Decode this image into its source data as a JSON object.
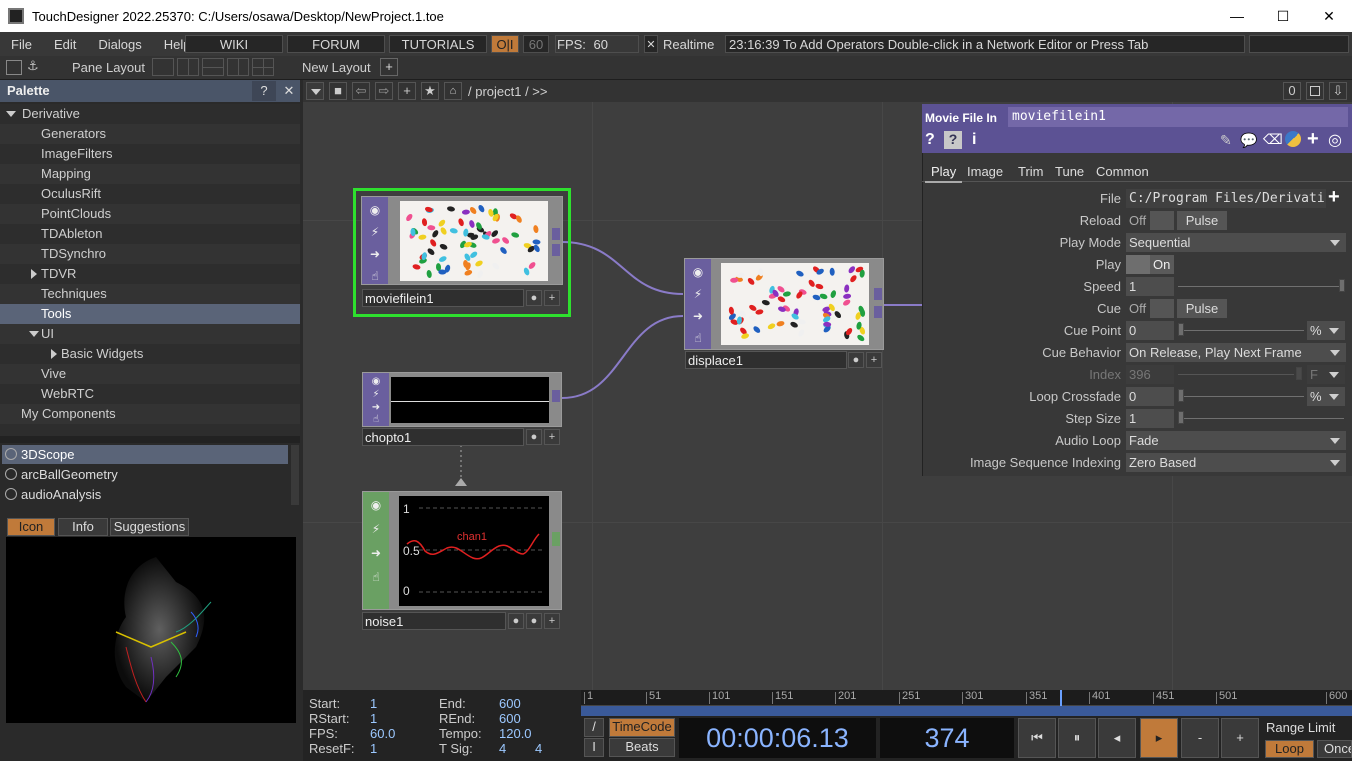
{
  "window": {
    "title": "TouchDesigner 2022.25370: C:/Users/osawa/Desktop/NewProject.1.toe",
    "minimize": "—",
    "maximize": "☐",
    "close": "✕"
  },
  "menu": {
    "items": [
      "File",
      "Edit",
      "Dialogs",
      "Help"
    ],
    "wiki": "WIKI",
    "forum": "FORUM",
    "tutorials": "TUTORIALS",
    "oi": "O|I",
    "fps_box": "60",
    "fps_label": "FPS:",
    "fps_value": "60",
    "realtime_label": "Realtime",
    "status": "23:16:39 To Add Operators Double-click in a Network Editor or Press Tab"
  },
  "toolbar": {
    "pane_layout": "Pane Layout",
    "new_layout": "New Layout"
  },
  "palette": {
    "title": "Palette",
    "help": "?",
    "close": "✕",
    "tree": [
      {
        "label": "Derivative",
        "indent": 0,
        "arrow": "down"
      },
      {
        "label": "Generators",
        "indent": 2
      },
      {
        "label": "ImageFilters",
        "indent": 2
      },
      {
        "label": "Mapping",
        "indent": 2
      },
      {
        "label": "OculusRift",
        "indent": 2
      },
      {
        "label": "PointClouds",
        "indent": 2
      },
      {
        "label": "TDAbleton",
        "indent": 2
      },
      {
        "label": "TDSynchro",
        "indent": 2
      },
      {
        "label": "TDVR",
        "indent": 2,
        "arrow": "right"
      },
      {
        "label": "Techniques",
        "indent": 2
      },
      {
        "label": "Tools",
        "indent": 2,
        "selected": true
      },
      {
        "label": "UI",
        "indent": 2,
        "arrow": "down"
      },
      {
        "label": "Basic Widgets",
        "indent": 3,
        "arrow": "right"
      },
      {
        "label": "Vive",
        "indent": 2
      },
      {
        "label": "WebRTC",
        "indent": 2
      },
      {
        "label": "My Components",
        "indent": 1
      }
    ],
    "components": [
      "3DScope",
      "arcBallGeometry",
      "audioAnalysis"
    ],
    "tabs": {
      "icon": "Icon",
      "info": "Info",
      "suggestions": "Suggestions"
    }
  },
  "network": {
    "path": "/ project1 / >>",
    "counter": "0",
    "nodes": {
      "moviefilein": "moviefilein1",
      "displace": "displace1",
      "chopto": "chopto1",
      "noise": "noise1"
    },
    "chart": {
      "y_top": "1",
      "y_mid": "0.5",
      "y_bot": "0",
      "channel": "chan1"
    }
  },
  "params": {
    "op_type": "Movie File In",
    "op_name": "moviefilein1",
    "tabs": [
      "Play",
      "Image",
      "Trim",
      "Tune",
      "Common"
    ],
    "file_label": "File",
    "file_value": "C:/Program Files/Derivati",
    "reload_label": "Reload",
    "off": "Off",
    "pulse": "Pulse",
    "playmode_label": "Play Mode",
    "playmode_value": "Sequential",
    "play_label": "Play",
    "on": "On",
    "speed_label": "Speed",
    "speed_value": "1",
    "cue_label": "Cue",
    "cuepoint_label": "Cue Point",
    "cuepoint_value": "0",
    "percent": "%",
    "cuebehavior_label": "Cue Behavior",
    "cuebehavior_value": "On Release, Play Next Frame",
    "index_label": "Index",
    "index_value": "396",
    "index_unit": "F",
    "loopcross_label": "Loop Crossfade",
    "loopcross_value": "0",
    "stepsize_label": "Step Size",
    "stepsize_value": "1",
    "audioloop_label": "Audio Loop",
    "audioloop_value": "Fade",
    "imgseq_label": "Image Sequence Indexing",
    "imgseq_value": "Zero Based"
  },
  "timeline": {
    "start_label": "Start:",
    "start": "1",
    "end_label": "End:",
    "end": "600",
    "rstart_label": "RStart:",
    "rstart": "1",
    "rend_label": "REnd:",
    "rend": "600",
    "fps_label": "FPS:",
    "fps": "60.0",
    "tempo_label": "Tempo:",
    "tempo": "120.0",
    "resetf_label": "ResetF:",
    "resetf": "1",
    "tsig_label": "T Sig:",
    "tsig_a": "4",
    "tsig_b": "4",
    "ruler": [
      "1",
      "51",
      "101",
      "151",
      "201",
      "251",
      "301",
      "351",
      "401",
      "451",
      "501",
      "600"
    ],
    "timecode_btn": "TimeCode",
    "beats_btn": "Beats",
    "timecode": "00:00:06.13",
    "frame": "374",
    "range_limit": "Range Limit",
    "loop": "Loop",
    "once": "Once",
    "minus": "-",
    "plus": "+"
  }
}
